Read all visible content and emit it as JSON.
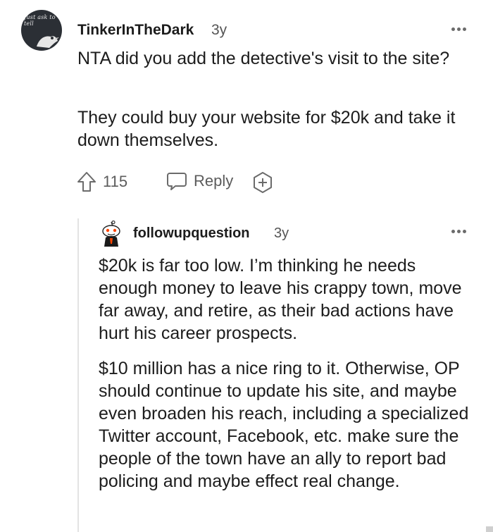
{
  "comment": {
    "avatar_text": "Just ask to tell",
    "username": "TinkerInTheDark",
    "age": "3y",
    "paragraphs": [
      "NTA did you add the detective's visit to the site?",
      "They could buy your website for $20k and take it down themselves."
    ],
    "upvotes": "115",
    "reply_label": "Reply"
  },
  "reply": {
    "username": "followupquestion",
    "age": "3y",
    "paragraphs": [
      "$20k is far too low. I’m thinking he needs enough money to leave his crappy town, move far away, and retire, as their bad actions have hurt his career prospects.",
      "$10 million has a nice ring to it. Otherwise, OP should continue to update his site, and maybe even broaden his reach, including a specialized Twitter account, Facebook, etc. make sure the people of the town have an ally to report bad policing and maybe effect real change."
    ]
  },
  "icons": {
    "upvote": "arrow-up-outline",
    "reply": "speech-bubble",
    "award": "hexagon-plus",
    "more": "three-dots"
  },
  "colors": {
    "text": "#1c1c1c",
    "meta": "#555555",
    "icon": "#5c5c5c",
    "thread_line": "#e3e3e3"
  }
}
